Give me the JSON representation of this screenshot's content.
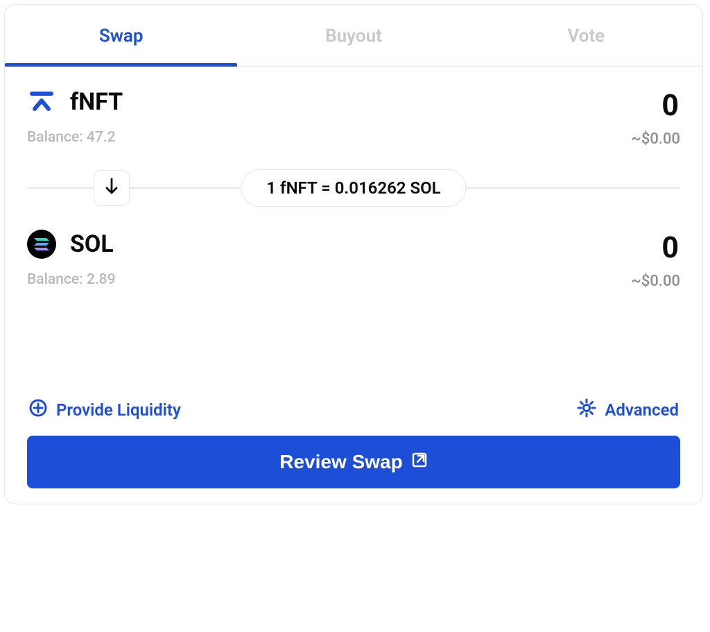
{
  "tabs": {
    "swap": "Swap",
    "buyout": "Buyout",
    "vote": "Vote"
  },
  "top": {
    "token": "fNFT",
    "balanceLabel": "Balance: 47.2",
    "amount": "0",
    "usd": "~$0.00"
  },
  "rate": "1 fNFT = 0.016262 SOL",
  "bottom": {
    "token": "SOL",
    "balanceLabel": "Balance: 2.89",
    "amount": "0",
    "usd": "~$0.00"
  },
  "links": {
    "liquidity": "Provide Liquidity",
    "advanced": "Advanced"
  },
  "cta": "Review Swap"
}
